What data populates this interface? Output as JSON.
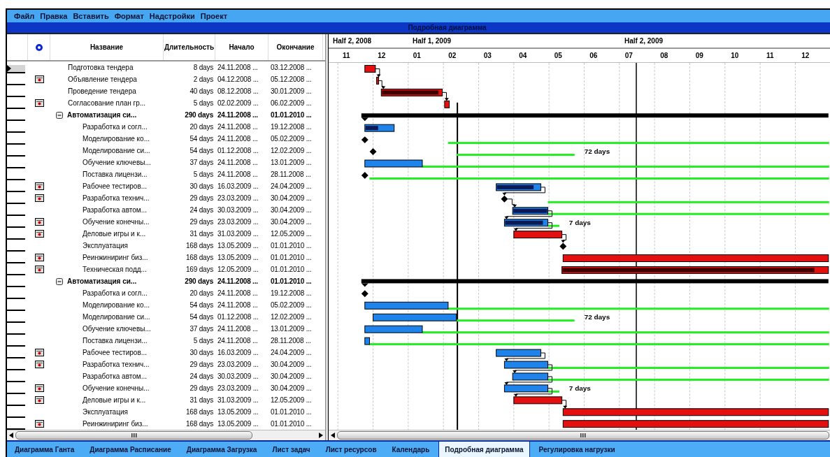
{
  "menu": [
    "Файл",
    "Правка",
    "Вставить",
    "Формат",
    "Надстройки",
    "Проект"
  ],
  "window": {
    "title": "Подробная диаграмма"
  },
  "table": {
    "columns": [
      "Название",
      "Длительность",
      "Начало",
      "Окончание"
    ]
  },
  "timescale": {
    "top": [
      "Half 2, 2008",
      "Half 1, 2009",
      "Half 2, 2009"
    ],
    "months": [
      "11",
      "12",
      "01",
      "02",
      "03",
      "04",
      "05",
      "06",
      "07",
      "08",
      "09",
      "10",
      "11",
      "12"
    ]
  },
  "rows": [
    {
      "name": "Подготовка тендера",
      "duration": "8 days",
      "start": "24.11.2008 ...",
      "finish": "03.12.2008 ...",
      "kind": "critical",
      "selected": true,
      "indicator": false
    },
    {
      "name": "Объявление тендера",
      "duration": "2 days",
      "start": "04.12.2008 ...",
      "finish": "05.12.2008 ...",
      "kind": "critical",
      "selected": false,
      "indicator": true,
      "linked": true
    },
    {
      "name": "Проведение тендера",
      "duration": "40 days",
      "start": "08.12.2008 ...",
      "finish": "30.01.2009 ...",
      "kind": "critical",
      "level": 0.95,
      "selected": false,
      "indicator": false,
      "linked": true
    },
    {
      "name": "Согласование план гр...",
      "duration": "5 days",
      "start": "02.02.2009 ...",
      "finish": "06.02.2009 ...",
      "kind": "critical",
      "selected": false,
      "indicator": true,
      "linked": true
    },
    {
      "name": "Автоматизация си...",
      "duration": "290 days",
      "start": "24.11.2008 ...",
      "finish": "01.01.2010 ...",
      "kind": "summary",
      "expanded": true,
      "selected": false,
      "indicator": false,
      "children": [
        {
          "name": "Разработка и согл...",
          "duration": "20 days",
          "start": "24.11.2008 ...",
          "finish": "19.12.2008 ...",
          "kind": "task",
          "level": 0.45,
          "selected": false,
          "indicator": false
        },
        {
          "name": "Моделирование ко...",
          "duration": "54 days",
          "start": "24.11.2008 ...",
          "finish": "05.02.2009 ...",
          "kind": "milestone",
          "selected": false,
          "indicator": false,
          "slack": true
        },
        {
          "name": "Моделирование си...",
          "duration": "54 days",
          "start": "01.12.2008 ...",
          "finish": "12.02.2009 ...",
          "kind": "milestone",
          "selected": false,
          "indicator": false,
          "slack": true,
          "bar_label": "72 days"
        },
        {
          "name": "Обучение ключевы...",
          "duration": "37 days",
          "start": "24.11.2008 ...",
          "finish": "13.01.2009 ...",
          "kind": "task",
          "selected": false,
          "indicator": false,
          "slack": true
        },
        {
          "name": "Поставка лицензи...",
          "duration": "5 days",
          "start": "24.11.2008 ...",
          "finish": "28.11.2008 ...",
          "kind": "milestone",
          "selected": false,
          "indicator": false,
          "slack": true
        },
        {
          "name": "Рабочее тестиров...",
          "duration": "30 days",
          "start": "16.03.2009 ...",
          "finish": "24.04.2009 ...",
          "kind": "task",
          "level": 0.85,
          "selected": false,
          "indicator": true
        },
        {
          "name": "Разработка технич...",
          "duration": "29 days",
          "start": "23.03.2009 ...",
          "finish": "30.04.2009 ...",
          "kind": "milestone",
          "selected": false,
          "indicator": true,
          "linked": true,
          "slack": true
        },
        {
          "name": "Разработка автом...",
          "duration": "24 days",
          "start": "30.03.2009 ...",
          "finish": "30.04.2009 ...",
          "kind": "task",
          "level": 1,
          "selected": false,
          "indicator": false,
          "linked": true,
          "slack": true
        },
        {
          "name": "Обучение конечны...",
          "duration": "29 days",
          "start": "23.03.2009 ...",
          "finish": "30.04.2009 ...",
          "kind": "task",
          "level": 0.9,
          "selected": false,
          "indicator": true,
          "linked": true,
          "slack": true,
          "bar_label": "7 days"
        },
        {
          "name": "Деловые игры и к...",
          "duration": "31 days",
          "start": "31.03.2009 ...",
          "finish": "12.05.2009 ...",
          "kind": "critical",
          "selected": false,
          "indicator": true,
          "linked": true
        },
        {
          "name": "Эксплуатация",
          "duration": "168 days",
          "start": "13.05.2009 ...",
          "finish": "01.01.2010 ...",
          "kind": "milestone",
          "selected": false,
          "indicator": false,
          "linked": true
        },
        {
          "name": "Реинжиниринг биз...",
          "duration": "168 days",
          "start": "13.05.2009 ...",
          "finish": "01.01.2010 ...",
          "kind": "critical",
          "selected": false,
          "indicator": true
        },
        {
          "name": "Техническая подд...",
          "duration": "169 days",
          "start": "12.05.2009 ...",
          "finish": "01.01.2010 ...",
          "kind": "critical",
          "level": 0.95,
          "selected": false,
          "indicator": true
        }
      ]
    },
    {
      "name": "Автоматизация си...",
      "duration": "290 days",
      "start": "24.11.2008 ...",
      "finish": "01.01.2010 ...",
      "kind": "summary",
      "expanded": true,
      "selected": false,
      "indicator": false,
      "children": [
        {
          "name": "Разработка и согл...",
          "duration": "20 days",
          "start": "24.11.2008 ...",
          "finish": "19.12.2008 ...",
          "kind": "milestone",
          "selected": false,
          "indicator": false
        },
        {
          "name": "Моделирование ко...",
          "duration": "54 days",
          "start": "24.11.2008 ...",
          "finish": "05.02.2009 ...",
          "kind": "task",
          "selected": false,
          "indicator": false,
          "slack": true
        },
        {
          "name": "Моделирование си...",
          "duration": "54 days",
          "start": "01.12.2008 ...",
          "finish": "12.02.2009 ...",
          "kind": "task",
          "selected": false,
          "indicator": false,
          "slack": true,
          "bar_label": "72 days"
        },
        {
          "name": "Обучение ключевы...",
          "duration": "37 days",
          "start": "24.11.2008 ...",
          "finish": "13.01.2009 ...",
          "kind": "task",
          "selected": false,
          "indicator": false,
          "slack": true
        },
        {
          "name": "Поставка лицензи...",
          "duration": "5 days",
          "start": "24.11.2008 ...",
          "finish": "28.11.2008 ...",
          "kind": "task",
          "selected": false,
          "indicator": false,
          "slack": true
        },
        {
          "name": "Рабочее тестиров...",
          "duration": "30 days",
          "start": "16.03.2009 ...",
          "finish": "24.04.2009 ...",
          "kind": "task",
          "selected": false,
          "indicator": true
        },
        {
          "name": "Разработка технич...",
          "duration": "29 days",
          "start": "23.03.2009 ...",
          "finish": "30.04.2009 ...",
          "kind": "task",
          "selected": false,
          "indicator": true,
          "linked": true,
          "slack": true
        },
        {
          "name": "Разработка автом...",
          "duration": "24 days",
          "start": "30.03.2009 ...",
          "finish": "30.04.2009 ...",
          "kind": "task",
          "selected": false,
          "indicator": false,
          "linked": true,
          "slack": true
        },
        {
          "name": "Обучение конечны...",
          "duration": "29 days",
          "start": "23.03.2009 ...",
          "finish": "30.04.2009 ...",
          "kind": "task",
          "selected": false,
          "indicator": true,
          "linked": true,
          "slack": true,
          "bar_label": "7 days"
        },
        {
          "name": "Деловые игры и к...",
          "duration": "31 days",
          "start": "31.03.2009 ...",
          "finish": "12.05.2009 ...",
          "kind": "critical",
          "selected": false,
          "indicator": true,
          "linked": true
        },
        {
          "name": "Эксплуатация",
          "duration": "168 days",
          "start": "13.05.2009 ...",
          "finish": "01.01.2010 ...",
          "kind": "critical",
          "selected": false,
          "indicator": false,
          "linked": true
        },
        {
          "name": "Реинжиниринг биз...",
          "duration": "168 days",
          "start": "13.05.2009 ...",
          "finish": "01.01.2010 ...",
          "kind": "critical",
          "selected": false,
          "indicator": true
        }
      ]
    }
  ],
  "tabs": [
    {
      "label": "Диаграмма Ганта",
      "selected": false
    },
    {
      "label": "Диаграмма Расписание",
      "selected": false
    },
    {
      "label": "Диаграмма Загрузка",
      "selected": false
    },
    {
      "label": "Лист задач",
      "selected": false
    },
    {
      "label": "Лист ресурсов",
      "selected": false
    },
    {
      "label": "Календарь",
      "selected": false
    },
    {
      "label": "Подробная диаграмма",
      "selected": true
    },
    {
      "label": "Регулировка нагрузки",
      "selected": false
    }
  ]
}
